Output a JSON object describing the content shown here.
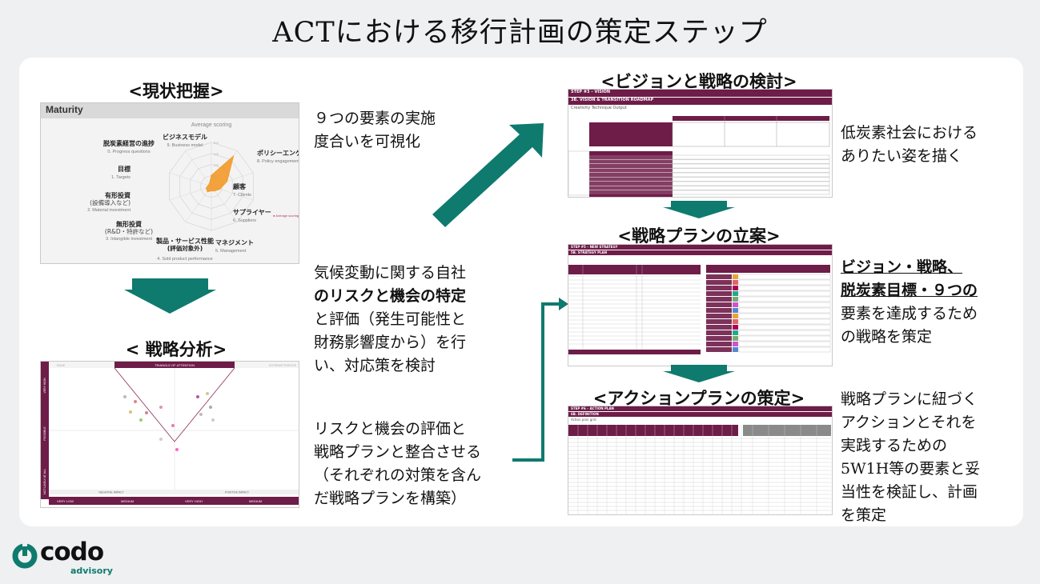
{
  "title": "ACTにおける移行計画の策定ステップ",
  "colors": {
    "accent": "#0f7a6e",
    "maroon": "#6e1c48",
    "radar_fill": "#f39a2a"
  },
  "left": {
    "current": {
      "heading": "<現状把握>",
      "desc_lines": [
        "９つの要素の実施",
        "度合いを可視化"
      ],
      "radar": {
        "header": "Maturity",
        "subtitle": "Average scoring",
        "legend": "Average scoring",
        "ticks": [
          "0.5",
          "1.0",
          "1.5",
          "2.0"
        ],
        "labels": [
          {
            "ja": "ビジネスモデル",
            "en": "9. Business model"
          },
          {
            "ja": "ポリシーエンゲージメント",
            "en": "8. Policy engagement"
          },
          {
            "ja": "顧客",
            "en": "7. Clients"
          },
          {
            "ja": "サプライヤー",
            "en": "6. Suppliers"
          },
          {
            "ja": "マネジメント",
            "en": "5. Management"
          },
          {
            "ja": "製品・サービス性能",
            "ja2": "(評価対象外)",
            "en": "4. Sold product performance"
          },
          {
            "ja": "無形投資",
            "ja2": "(R&D・特許など)",
            "en": "3. Intangible investment"
          },
          {
            "ja": "有形投資",
            "ja2": "(設備導入など)",
            "en": "2. Material investment"
          },
          {
            "ja": "目標",
            "en": "1. Targets"
          },
          {
            "ja": "脱炭素経営の進捗",
            "en": "0. Progress questions"
          }
        ],
        "values": [
          1.0,
          3.4,
          1.5,
          0.8,
          0.5,
          0.4,
          0.6,
          0.5,
          0.3,
          0.3
        ]
      }
    },
    "analysis": {
      "heading": "< 戦略分析>",
      "desc1_lines": [
        "気候変動に関する自社",
        "のリスクと機会の特定",
        "と評価（発生可能性と",
        "財務影響度から）を行",
        "い、対応策を検討"
      ],
      "desc2_lines": [
        "リスクと機会の評価と",
        "戦略プランと整合させる",
        "（それぞれの対策を含ん",
        "だ戦略プランを構築）"
      ],
      "matrix": {
        "title": "TRIANGLE OF ATTENTION",
        "left_top": "NONE",
        "right_top": "EXTREME POSITIVE",
        "ylabels": [
          "VERY HIGH",
          "POSSIBLE",
          "NOT LIKELY AT ALL"
        ],
        "neg": "NEGATIVE IMPACT",
        "pos": "POSITIVE IMPACT",
        "bottom": [
          "VERY LOW",
          "MEDIUM",
          "VERY HIGH",
          "MEDIUM"
        ]
      }
    }
  },
  "right": {
    "vision": {
      "heading": "<ビジョンと戦略の検討>",
      "desc_lines": [
        "低炭素社会における",
        "ありたい姿を描く"
      ],
      "sheet": {
        "step": "STEP #3 – VISION",
        "sub": "3B. VISION & TRANSITION ROADMAP",
        "head": "Creativity Technique Output"
      }
    },
    "strategy": {
      "heading": "<戦略プランの立案>",
      "desc_lines": [
        "ビジョン・戦略、",
        "脱炭素目標・９つの",
        "要素を達成するため",
        "の戦略を策定"
      ],
      "sheet": {
        "step": "STEP #5 – NEW STRATEGY",
        "sub": "5B. STRATEGY PLAN"
      }
    },
    "action": {
      "heading": "<アクションプランの策定>",
      "desc_lines": [
        "戦略プランに紐づく",
        "アクションとそれを",
        "実践するための",
        "5W1H等の要素と妥",
        "当性を検証し、計画",
        "を策定"
      ],
      "sheet": {
        "step": "STEP #6 – ACTION PLAN",
        "sub": "6B. DEFINITION",
        "head": "Action plan grid"
      }
    }
  },
  "logo": {
    "name": "codo",
    "sub": "advisory"
  }
}
